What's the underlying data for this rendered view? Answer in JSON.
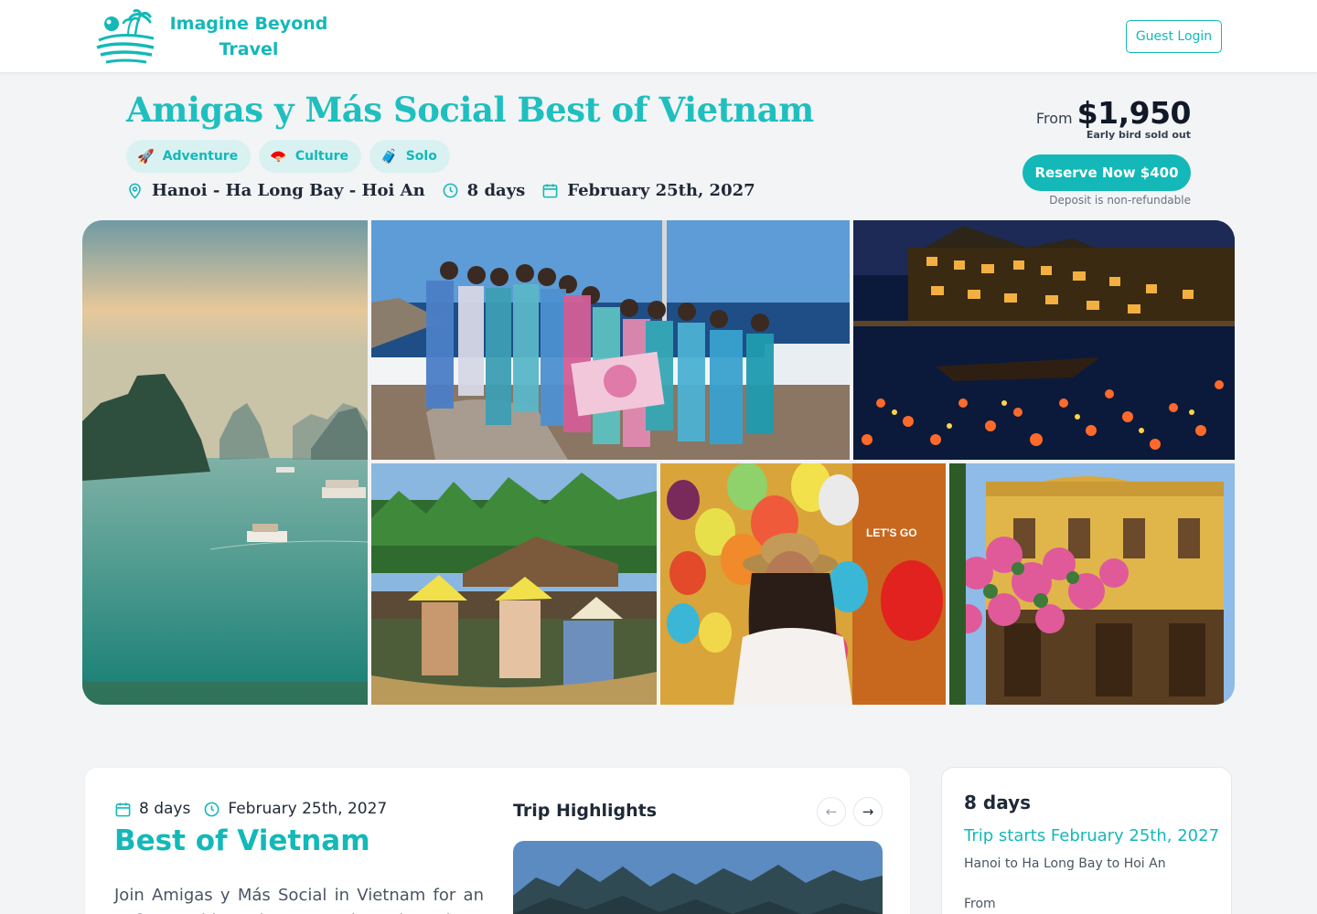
{
  "header": {
    "brand_line1": "Imagine Beyond",
    "brand_line2": "Travel",
    "guest_login": "Guest Login"
  },
  "trip": {
    "title": "Amigas y Más Social Best of Vietnam",
    "tags": [
      {
        "label": "Adventure",
        "icon": "rocket-icon",
        "glyph": "🚀"
      },
      {
        "label": "Culture",
        "icon": "fan-icon",
        "glyph": "🪭"
      },
      {
        "label": "Solo",
        "icon": "suitcase-icon",
        "glyph": "🧳"
      }
    ],
    "route": "Hanoi - Ha Long Bay - Hoi An",
    "duration": "8 days",
    "date": "February 25th, 2027"
  },
  "pricing": {
    "from_label": "From",
    "price": "$1,950",
    "early_bird": "Early bird sold out",
    "reserve_label": "Reserve Now $400",
    "deposit_note": "Deposit is non-refundable"
  },
  "gallery": {
    "photos": [
      "ha-long-bay-photo",
      "group-photo",
      "hoi-an-night-lanterns-photo",
      "boat-ride-photo",
      "lantern-shop-photo",
      "yellow-building-flowers-photo"
    ]
  },
  "overview": {
    "duration": "8 days",
    "date": "February 25th, 2027",
    "title": "Best of Vietnam",
    "description": "Join Amigas y Más Social in Vietnam for an unforgettable adventure through culture and",
    "highlights_title": "Trip Highlights",
    "prev_glyph": "←",
    "next_glyph": "→"
  },
  "summary": {
    "duration": "8 days",
    "start": "Trip starts February 25th, 2027",
    "route": "Hanoi to Ha Long Bay to Hoi An",
    "from_label": "From"
  },
  "colors": {
    "accent": "#14b8b8",
    "tag_bg": "#d9f1f1",
    "page_bg": "#f3f4f6"
  }
}
